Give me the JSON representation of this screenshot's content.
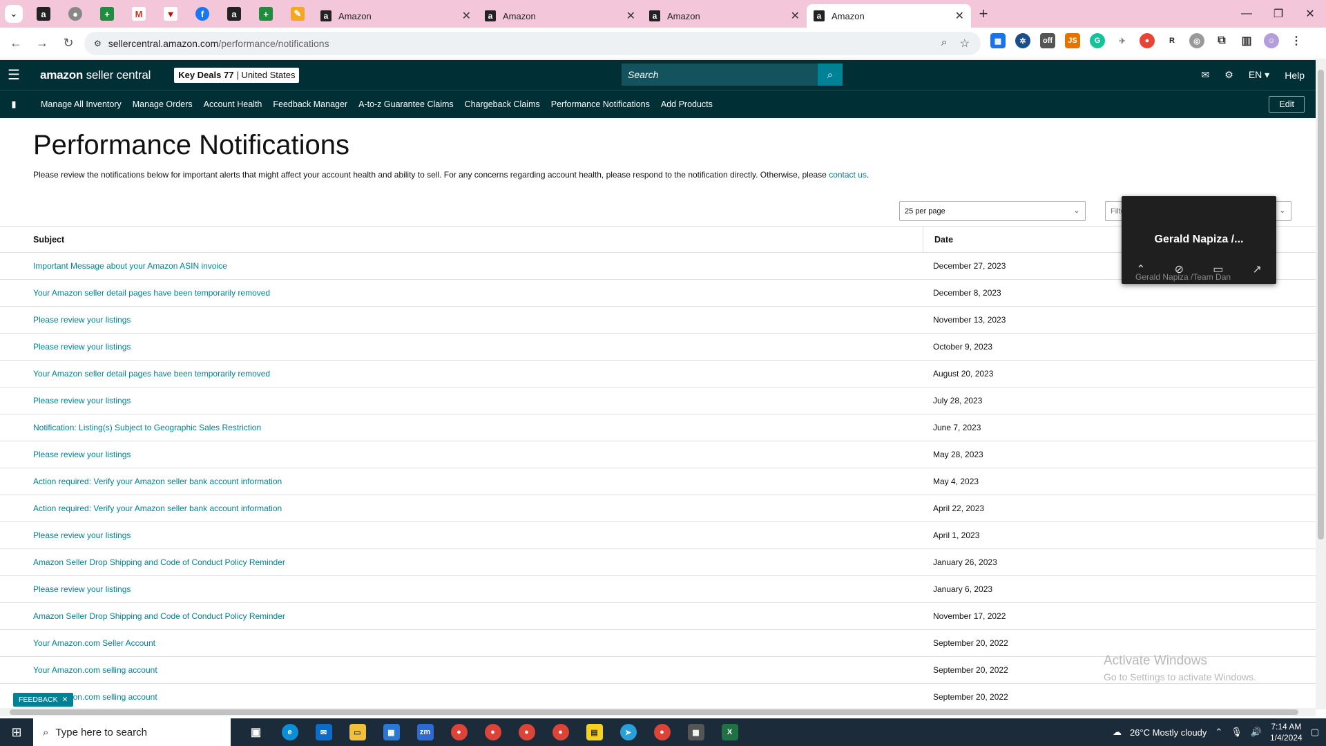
{
  "browser": {
    "tabs": [
      {
        "title": "Amazon",
        "active": false
      },
      {
        "title": "Amazon",
        "active": false
      },
      {
        "title": "Amazon",
        "active": false
      },
      {
        "title": "Amazon",
        "active": true
      }
    ],
    "url_host": "sellercentral.amazon.com",
    "url_path": "/performance/notifications"
  },
  "header": {
    "logo_bold": "amazon",
    "logo_rest": " seller central",
    "store_name": "Key Deals 77",
    "store_region": "| United States",
    "search_placeholder": "Search",
    "lang": "EN",
    "help": "Help"
  },
  "nav": {
    "links": [
      "Manage All Inventory",
      "Manage Orders",
      "Account Health",
      "Feedback Manager",
      "A-to-z Guarantee Claims",
      "Chargeback Claims",
      "Performance Notifications",
      "Add Products"
    ],
    "edit": "Edit"
  },
  "page": {
    "title": "Performance Notifications",
    "intro": "Please review the notifications below for important alerts that might affect your account health and ability to sell. For any concerns regarding account health, please respond to the notification directly. Otherwise, please ",
    "intro_link": "contact us",
    "per_page": "25 per page",
    "filter_placeholder": "Filte"
  },
  "table": {
    "headers": {
      "subject": "Subject",
      "date": "Date"
    },
    "rows": [
      {
        "subject": "Important Message about your Amazon ASIN invoice",
        "date": "December 27, 2023"
      },
      {
        "subject": "Your Amazon seller detail pages have been temporarily removed",
        "date": "December 8, 2023"
      },
      {
        "subject": "Please review your listings",
        "date": "November 13, 2023"
      },
      {
        "subject": "Please review your listings",
        "date": "October 9, 2023"
      },
      {
        "subject": "Your Amazon seller detail pages have been temporarily removed",
        "date": "August 20, 2023"
      },
      {
        "subject": "Please review your listings",
        "date": "July 28, 2023"
      },
      {
        "subject": "Notification: Listing(s) Subject to Geographic Sales Restriction",
        "date": "June 7, 2023"
      },
      {
        "subject": "Please review your listings",
        "date": "May 28, 2023"
      },
      {
        "subject": "Action required: Verify your Amazon seller bank account information",
        "date": "May 4, 2023"
      },
      {
        "subject": "Action required: Verify your Amazon seller bank account information",
        "date": "April 22, 2023"
      },
      {
        "subject": "Please review your listings",
        "date": "April 1, 2023"
      },
      {
        "subject": "Amazon Seller Drop Shipping and Code of Conduct Policy Reminder",
        "date": "January 26, 2023"
      },
      {
        "subject": "Please review your listings",
        "date": "January 6, 2023"
      },
      {
        "subject": "Amazon Seller Drop Shipping and Code of Conduct Policy Reminder",
        "date": "November 17, 2022"
      },
      {
        "subject": "Your Amazon.com Seller Account",
        "date": "September 20, 2022"
      },
      {
        "subject": "Your Amazon.com selling account",
        "date": "September 20, 2022"
      },
      {
        "subject": "Your Amazon.com selling account",
        "date": "September 20, 2022"
      }
    ]
  },
  "zoom": {
    "name": "Gerald Napiza /...",
    "sub": "Gerald Napiza /Team Dan"
  },
  "watermark": {
    "line1": "Activate Windows",
    "line2": "Go to Settings to activate Windows."
  },
  "feedback": "FEEDBACK",
  "taskbar": {
    "search_placeholder": "Type here to search",
    "weather": "26°C  Mostly cloudy",
    "time": "7:14 AM",
    "date": "1/4/2024"
  },
  "colors": {
    "header_bg": "#002f36",
    "link": "#008296",
    "tabbar": "#f4c6d9"
  }
}
